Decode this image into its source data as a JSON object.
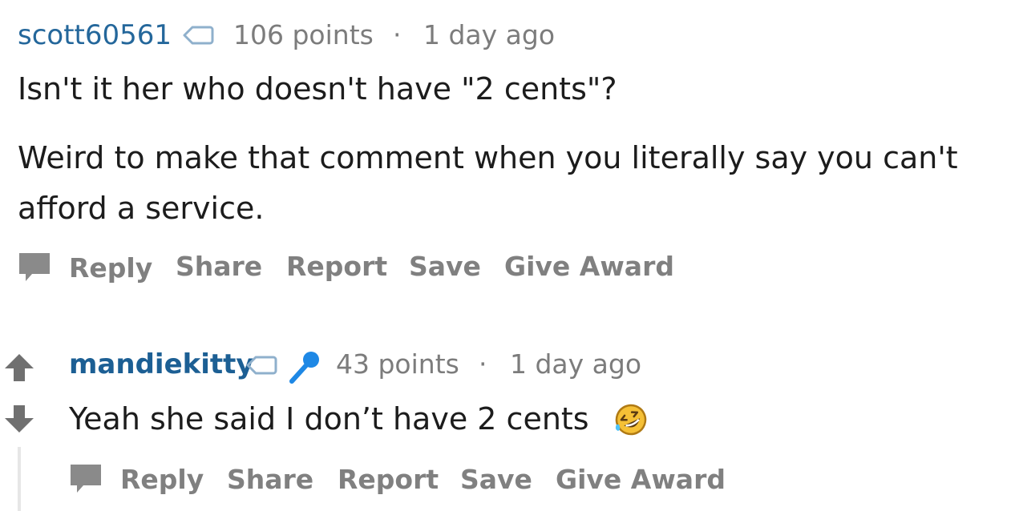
{
  "comments": [
    {
      "username": "scott60561",
      "points": "106 points",
      "separator": "·",
      "time": "1 day ago",
      "body": [
        "Isn't it her who doesn't have \"2 cents\"?",
        "Weird to make that comment when you literally say you can't",
        "afford a service."
      ],
      "actions": [
        "Reply",
        "Share",
        "Report",
        "Save",
        "Give Award"
      ]
    },
    {
      "username": "mandiekitty",
      "points": "43 points",
      "separator": "·",
      "time": "1 day ago",
      "body": [
        "Yeah she said I don’t have 2 cents"
      ],
      "actions": [
        "Reply",
        "Share",
        "Report",
        "Save",
        "Give Award"
      ]
    }
  ],
  "icons": {
    "flair": "tag-icon",
    "mic": "microphone-icon",
    "emoji": "rofl-emoji-icon",
    "reply": "speech-bubble-icon",
    "upvote": "upvote-arrow-icon",
    "downvote": "downvote-arrow-icon"
  },
  "colors": {
    "username": "#24679b",
    "meta": "#7c7c7c",
    "action": "#808080",
    "mic": "#1e88e5"
  }
}
